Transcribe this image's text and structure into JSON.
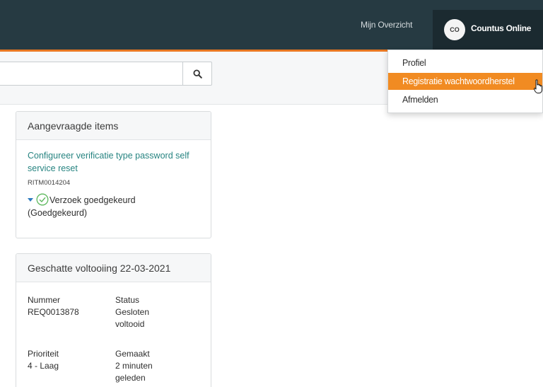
{
  "header": {
    "nav_link": "Mijn Overzicht",
    "user_initials": "CO",
    "user_name": "Countus Online"
  },
  "user_menu": {
    "items": [
      {
        "label": "Profiel"
      },
      {
        "label": "Registratie wachtwoordherstel",
        "active": true
      },
      {
        "label": "Afmelden"
      }
    ]
  },
  "search": {
    "value": "",
    "icon": "search-icon"
  },
  "requested_items": {
    "title": "Aangevraagde items",
    "item": {
      "link": "Configureer verificatie type password self service reset",
      "number": "RITM0014204",
      "status": "Verzoek goedgekeurd",
      "status_detail": "(Goedgekeurd)"
    }
  },
  "estimate": {
    "title": "Geschatte voltooiing 22-03-2021",
    "fields": {
      "number_label": "Nummer",
      "number_value": "REQ0013878",
      "status_label": "Status",
      "status_value": "Gesloten voltooid",
      "priority_label": "Prioriteit",
      "priority_value": "4 - Laag",
      "created_label": "Gemaakt",
      "created_value": "2 minuten geleden"
    }
  },
  "colors": {
    "header": "#263a42",
    "accent": "#e87722",
    "link": "#278481",
    "menu_active": "#f18b22",
    "approved": "#5cb85c"
  }
}
